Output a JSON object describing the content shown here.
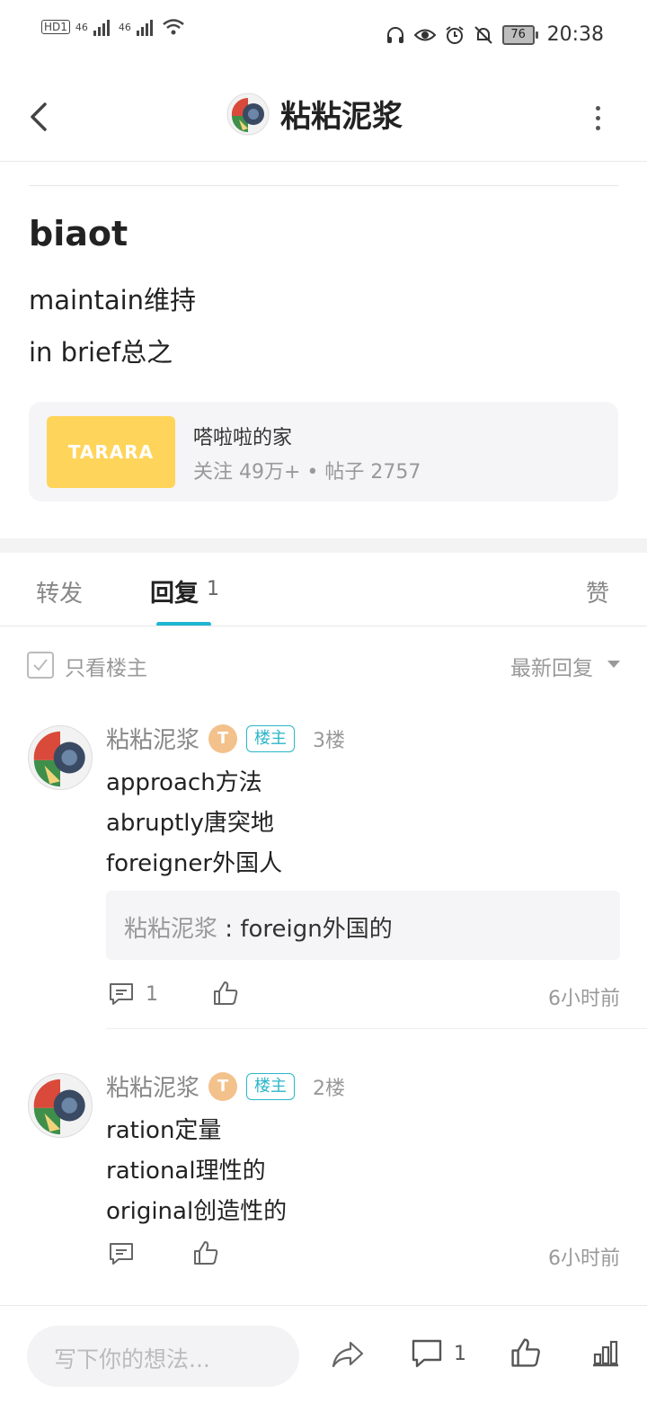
{
  "status_bar": {
    "left_labels": [
      "HD1",
      "46",
      "46"
    ],
    "battery": "76",
    "time": "20:38"
  },
  "header": {
    "title": "粘粘泥浆"
  },
  "post": {
    "title": "biaot",
    "lines": [
      "maintain维持",
      "in brief总之"
    ]
  },
  "forum": {
    "logo_text": "TARARA",
    "name": "嗒啦啦的家",
    "stats": "关注 49万+ • 帖子 2757"
  },
  "tabs": {
    "repost": "转发",
    "reply": "回复",
    "reply_count": "1",
    "like": "赞"
  },
  "filter": {
    "only_host": "只看楼主",
    "sort": "最新回复"
  },
  "replies": [
    {
      "user": "粘粘泥浆",
      "level": "T",
      "badge": "楼主",
      "floor": "3楼",
      "lines": [
        "approach方法",
        "abruptly唐突地",
        "foreigner外国人"
      ],
      "quote_user": "粘粘泥浆",
      "quote_sep": " : ",
      "quote_text": "foreign外国的",
      "comment_count": "1",
      "time": "6小时前"
    },
    {
      "user": "粘粘泥浆",
      "level": "T",
      "badge": "楼主",
      "floor": "2楼",
      "lines": [
        "ration定量",
        "rational理性的",
        "original创造性的"
      ],
      "time": "6小时前"
    }
  ],
  "bottom_bar": {
    "placeholder": "写下你的想法...",
    "comment_count": "1"
  },
  "colors": {
    "accent": "#1eb6d0",
    "forum_logo": "#ffd45a",
    "badge": "#2bb6c9"
  }
}
